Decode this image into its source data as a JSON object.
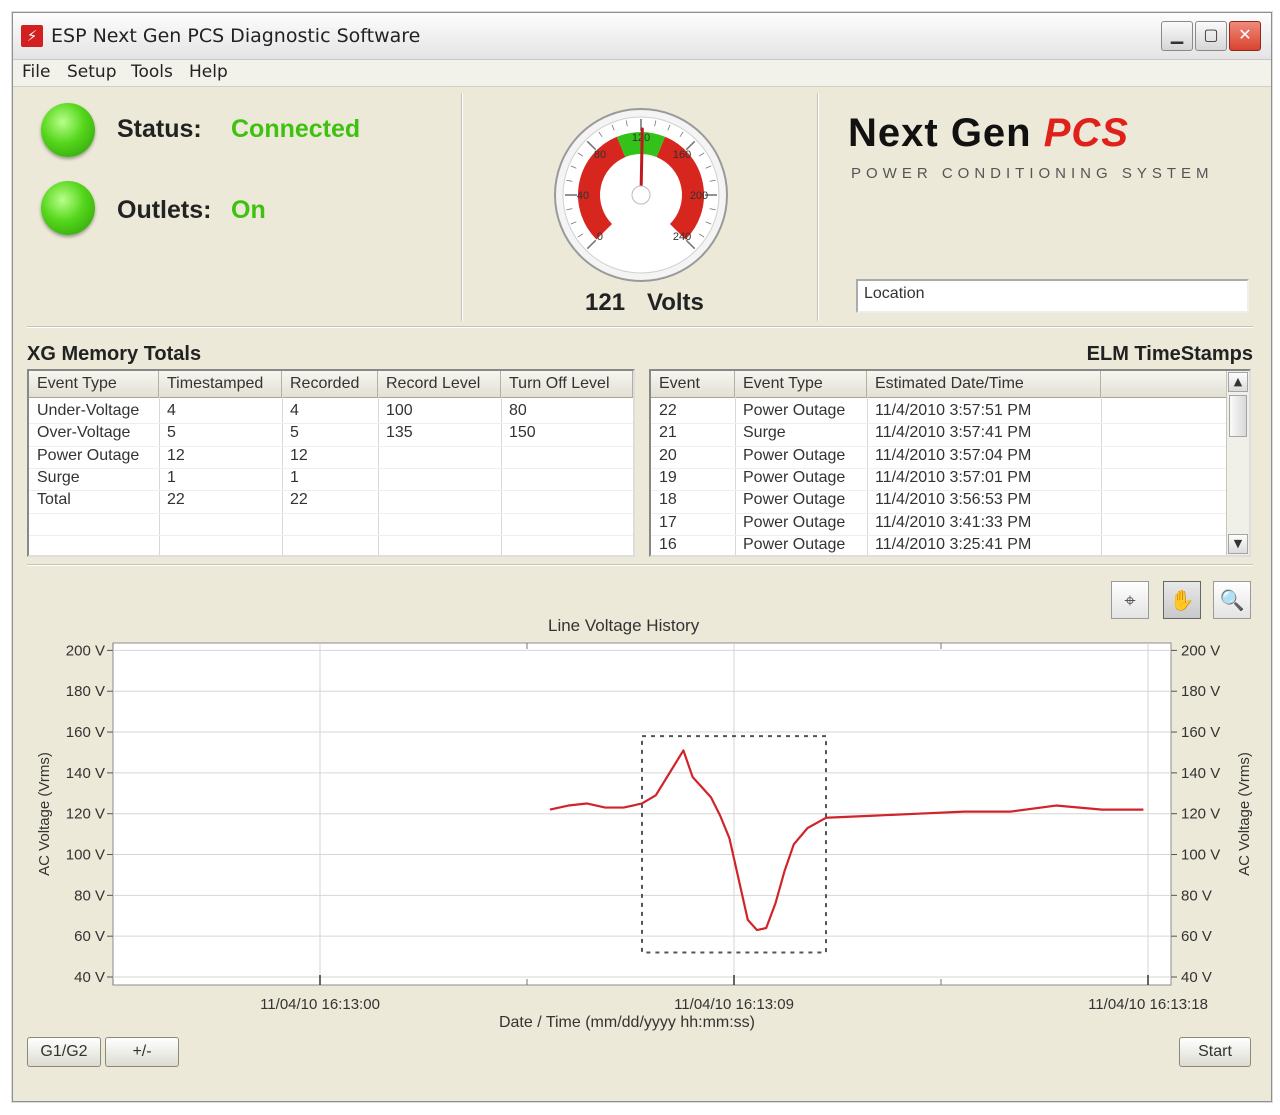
{
  "window": {
    "title": "ESP Next Gen PCS Diagnostic Software",
    "controls": [
      "minimize",
      "maximize",
      "close"
    ]
  },
  "menu": {
    "items": [
      "File",
      "Setup",
      "Tools",
      "Help"
    ]
  },
  "status": {
    "status_label": "Status:",
    "status_value": "Connected",
    "outlets_label": "Outlets:",
    "outlets_value": "On",
    "led_color": "#55d61b",
    "value_color": "#3ec20f"
  },
  "gauge": {
    "reading": "121",
    "unit": "Volts",
    "value": 121,
    "min": 0,
    "max": 240,
    "tick_labels": [
      "0",
      "40",
      "80",
      "120",
      "160",
      "200",
      "240"
    ]
  },
  "logo": {
    "main_a": "Next Gen",
    "main_b": "PCS",
    "tagline": "POWER CONDITIONING SYSTEM",
    "brand_color": "#e0211b"
  },
  "location": {
    "value": "Location"
  },
  "memory_totals": {
    "title": "XG Memory Totals",
    "columns": [
      "Event Type",
      "Timestamped",
      "Recorded",
      "Record Level",
      "Turn Off Level"
    ],
    "rows": [
      [
        "Under-Voltage",
        "4",
        "4",
        "100",
        "80"
      ],
      [
        "Over-Voltage",
        "5",
        "5",
        "135",
        "150"
      ],
      [
        "Power Outage",
        "12",
        "12",
        "",
        ""
      ],
      [
        "Surge",
        "1",
        "1",
        "",
        ""
      ],
      [
        "Total",
        "22",
        "22",
        "",
        ""
      ]
    ]
  },
  "timestamps": {
    "title": "ELM TimeStamps",
    "columns": [
      "Event",
      "Event Type",
      "Estimated Date/Time"
    ],
    "rows": [
      [
        "22",
        "Power Outage",
        "11/4/2010 3:57:51 PM"
      ],
      [
        "21",
        "Surge",
        "11/4/2010 3:57:41 PM"
      ],
      [
        "20",
        "Power Outage",
        "11/4/2010 3:57:04 PM"
      ],
      [
        "19",
        "Power Outage",
        "11/4/2010 3:57:01 PM"
      ],
      [
        "18",
        "Power Outage",
        "11/4/2010 3:56:53 PM"
      ],
      [
        "17",
        "Power Outage",
        "11/4/2010 3:41:33 PM"
      ],
      [
        "16",
        "Power Outage",
        "11/4/2010 3:25:41 PM"
      ]
    ]
  },
  "chart_tools": [
    "crosshair-tool",
    "pan-tool",
    "zoom-tool"
  ],
  "chart_data": {
    "type": "line",
    "title": "Line Voltage History",
    "xlabel": "Date / Time (mm/dd/yyyy hh:mm:ss)",
    "ylabel": "AC Voltage (Vrms)",
    "ylim": [
      40,
      200
    ],
    "yticks": [
      "200 V",
      "180 V",
      "160 V",
      "140 V",
      "120 V",
      "100 V",
      "80 V",
      "60 V",
      "40 V"
    ],
    "x_tick_labels": [
      "11/04/10 16:13:00",
      "11/04/10 16:13:09",
      "11/04/10 16:13:18"
    ],
    "xlim": [
      -4.5,
      18.5
    ],
    "grid": true,
    "line_color": "#d1232a",
    "series": [
      {
        "x": [
          5.0,
          5.4,
          5.8,
          6.2,
          6.6,
          7.0,
          7.3,
          7.6,
          7.9,
          8.1,
          8.3,
          8.5,
          8.7,
          8.9,
          9.1,
          9.3,
          9.5,
          9.7,
          9.9,
          10.1,
          10.3,
          10.6,
          11.0,
          12.0,
          13.0,
          14.0,
          15.0,
          16.0,
          17.0,
          17.9
        ],
        "y": [
          122,
          124,
          125,
          123,
          123,
          125,
          129,
          140,
          151,
          138,
          133,
          128,
          119,
          108,
          88,
          68,
          63,
          64,
          76,
          92,
          105,
          113,
          118,
          119,
          120,
          121,
          121,
          124,
          122,
          122
        ]
      }
    ],
    "selection_box": {
      "x": [
        7.0,
        11.0
      ],
      "y": [
        52,
        158
      ]
    }
  },
  "buttons": {
    "g1g2": "G1/G2",
    "plusminus": "+/-",
    "start": "Start"
  }
}
